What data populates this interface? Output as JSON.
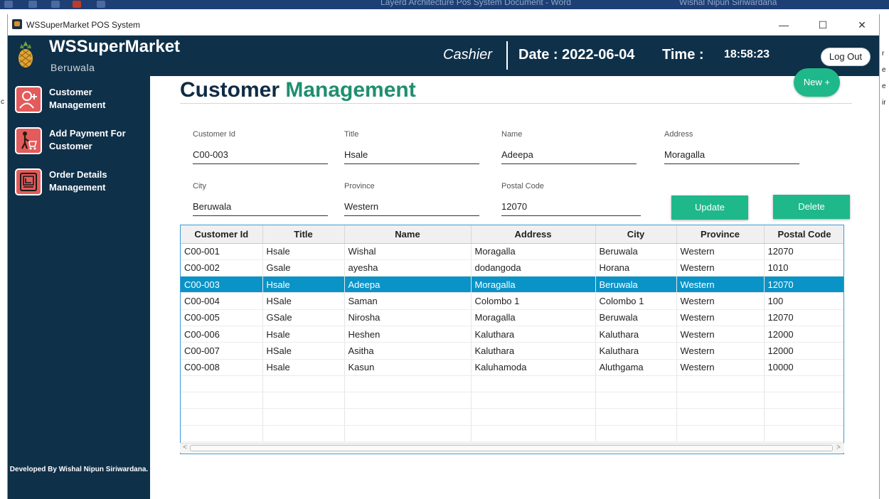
{
  "background": {
    "window_title": "Layerd Architecture Pos System Document - Word",
    "user_name": "Wishal Nipun Siriwardana"
  },
  "window": {
    "title": "WSSuperMarket POS System",
    "minimize_glyph": "—",
    "maximize_glyph": "☐",
    "close_glyph": "✕"
  },
  "header": {
    "brand": "WSSuperMarket",
    "branch": "Beruwala",
    "role": "Cashier",
    "date_text": "Date : 2022-06-04",
    "time_label": "Time :",
    "time_value": "18:58:23",
    "logout_label": "Log Out"
  },
  "sidebar": {
    "items": [
      {
        "label": "Customer Management",
        "icon": "add-user-icon"
      },
      {
        "label": "Add Payment For Customer",
        "icon": "cart-person-icon"
      },
      {
        "label": "Order Details Management",
        "icon": "order-book-icon"
      }
    ],
    "footer": "Developed By Wishal Nipun Siriwardana."
  },
  "page": {
    "title_part1": "Customer ",
    "title_part2": "Management",
    "new_button": "New +"
  },
  "form": {
    "customer_id": {
      "label": "Customer Id",
      "value": "C00-003"
    },
    "title": {
      "label": "Title",
      "value": "Hsale"
    },
    "name": {
      "label": "Name",
      "value": "Adeepa"
    },
    "address": {
      "label": "Address",
      "value": "Moragalla"
    },
    "city": {
      "label": "City",
      "value": "Beruwala"
    },
    "province": {
      "label": "Province",
      "value": "Western"
    },
    "postal_code": {
      "label": "Postal Code",
      "value": "12070"
    },
    "update_label": "Update",
    "delete_label": "Delete"
  },
  "table": {
    "columns": [
      "Customer Id",
      "Title",
      "Name",
      "Address",
      "City",
      "Province",
      "Postal Code"
    ],
    "selected_index": 2,
    "rows": [
      [
        "C00-001",
        "Hsale",
        "Wishal",
        "Moragalla",
        "Beruwala",
        "Western",
        "12070"
      ],
      [
        "C00-002",
        "Gsale",
        "ayesha",
        "dodangoda",
        "Horana",
        "Western",
        "1010"
      ],
      [
        "C00-003",
        "Hsale",
        "Adeepa",
        "Moragalla",
        "Beruwala",
        "Western",
        "12070"
      ],
      [
        "C00-004",
        "HSale",
        "Saman",
        "Colombo 1",
        "Colombo 1",
        "Western",
        "100"
      ],
      [
        "C00-005",
        "GSale",
        "Nirosha",
        "Moragalla",
        "Beruwala",
        "Western",
        "12070"
      ],
      [
        "C00-006",
        "Hsale",
        "Heshen",
        "Kaluthara",
        "Kaluthara",
        "Western",
        "12000"
      ],
      [
        "C00-007",
        "HSale",
        "Asitha",
        "Kaluthara",
        "Kaluthara",
        "Western",
        "12000"
      ],
      [
        "C00-008",
        "Hsale",
        "Kasun",
        "Kaluhamoda",
        "Aluthgama",
        "Western",
        "10000"
      ]
    ],
    "empty_rows": 4
  },
  "colors": {
    "header_bg": "#0f3049",
    "accent_green": "#1fb88a",
    "title_green": "#1f8f6e",
    "selection_blue": "#0a93c7",
    "sidebar_icon_red": "#e35b5b"
  }
}
